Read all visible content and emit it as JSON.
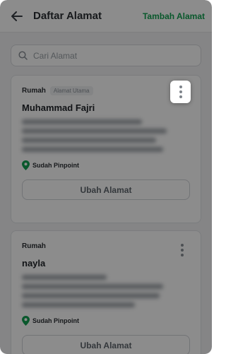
{
  "header": {
    "title": "Daftar Alamat",
    "add_label": "Tambah Alamat"
  },
  "search": {
    "placeholder": "Cari Alamat"
  },
  "addresses": [
    {
      "label": "Rumah",
      "badge": "Alamat Utama",
      "name": "Muhammad Fajri",
      "pinpoint": "Sudah Pinpoint",
      "button": "Ubah Alamat"
    },
    {
      "label": "Rumah",
      "name": "nayla",
      "pinpoint": "Sudah Pinpoint",
      "button": "Ubah Alamat"
    }
  ],
  "colors": {
    "accent": "#12a150",
    "pin": "#12a150"
  }
}
